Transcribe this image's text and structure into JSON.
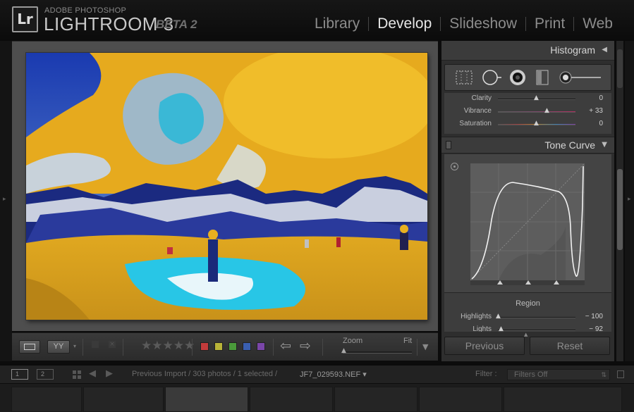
{
  "app": {
    "vendor": "ADOBE PHOTOSHOP",
    "product": "LIGHTROOM 3",
    "beta": "BETA 2",
    "logo": "Lr"
  },
  "modules": [
    {
      "label": "Library",
      "active": false
    },
    {
      "label": "Develop",
      "active": true
    },
    {
      "label": "Slideshow",
      "active": false
    },
    {
      "label": "Print",
      "active": false
    },
    {
      "label": "Web",
      "active": false
    }
  ],
  "toolbar": {
    "view_mode_icon": "loupe-view-icon",
    "before_after_label": "YY",
    "flag_icons": [
      "pick-flag-icon",
      "reject-flag-icon"
    ],
    "stars": "★★★★★",
    "color_labels": [
      "#c23b3b",
      "#b8b338",
      "#4a9a3a",
      "#3a5fb0",
      "#7a46a8"
    ],
    "zoom_label": "Zoom",
    "fit_label": "Fit"
  },
  "histogram": {
    "title": "Histogram",
    "toggle_icon": "collapse-left-icon",
    "tools": [
      "crop-overlay-icon",
      "spot-removal-icon",
      "red-eye-icon",
      "graduated-filter-icon",
      "adjustment-brush-icon"
    ]
  },
  "basic_sliders": [
    {
      "label": "Clarity",
      "value": "0",
      "position": 0.5
    },
    {
      "label": "Vibrance",
      "value": "+ 33",
      "position": 0.63
    },
    {
      "label": "Saturation",
      "value": "0",
      "position": 0.5
    }
  ],
  "tone_curve": {
    "title": "Tone Curve",
    "toggle_icon": "collapse-down-icon",
    "region_title": "Region",
    "region_sliders": [
      {
        "label": "Highlights",
        "value": "− 100",
        "position": 0.0
      },
      {
        "label": "Lights",
        "value": "− 92",
        "position": 0.04
      }
    ]
  },
  "buttons": {
    "previous": "Previous",
    "reset": "Reset"
  },
  "filmstrip": {
    "monitor_1": "1",
    "monitor_2": "2",
    "breadcrumb": "Previous Import / 303 photos / 1 selected /",
    "filename": "JF7_029593.NEF ▾",
    "filter_label": "Filter :",
    "filter_value": "Filters Off"
  }
}
